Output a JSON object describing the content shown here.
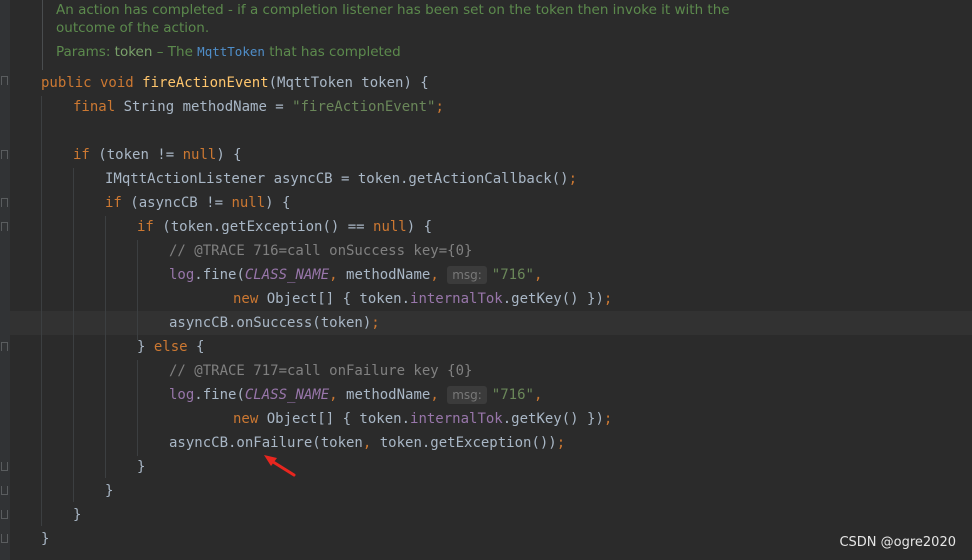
{
  "doc": {
    "line1": "An action has completed - if a completion listener has been set on the token then invoke it with the",
    "line2": "outcome of the action.",
    "params_label": "Params:",
    "param_name": "token",
    "param_dash": " – The ",
    "param_type": "MqttToken",
    "param_rest": " that has completed"
  },
  "code": {
    "l1": {
      "kw": "public void ",
      "fn": "fireActionEvent",
      "rest": "(MqttToken token) {"
    },
    "l2": {
      "kw": "final ",
      "a": "String methodName = ",
      "str": "\"fireActionEvent\"",
      "semi": ";"
    },
    "l4": {
      "kw": "if ",
      "a": "(token != ",
      "null": "null",
      "b": ") {"
    },
    "l5": {
      "a": "IMqttActionListener asyncCB = token.getActionCallback()",
      "semi": ";"
    },
    "l6": {
      "kw": "if ",
      "a": "(asyncCB != ",
      "null": "null",
      "b": ") {"
    },
    "l7": {
      "kw": "if ",
      "a": "(token.getException() == ",
      "null": "null",
      "b": ") {"
    },
    "l8": "// @TRACE 716=call onSuccess key={0}",
    "l9": {
      "field": "log",
      "a": ".fine(",
      "const": "CLASS_NAME",
      "comma": ", ",
      "b": "methodName",
      "comma2": ", ",
      "hint": "msg:",
      "str": "\"716\"",
      "comma3": ","
    },
    "l10": {
      "kw": "new ",
      "a": "Object[] { token.",
      "field": "internalTok",
      "b": ".getKey() })",
      "semi": ";"
    },
    "l11": {
      "a": "asyncCB.onSuccess(token)",
      "semi": ";"
    },
    "l12": {
      "a": "} ",
      "kw": "else",
      "b": " {"
    },
    "l13": "// @TRACE 717=call onFailure key {0}",
    "l14": {
      "field": "log",
      "a": ".fine(",
      "const": "CLASS_NAME",
      "comma": ", ",
      "b": "methodName",
      "comma2": ", ",
      "hint": "msg:",
      "str": "\"716\"",
      "comma3": ","
    },
    "l15": {
      "kw": "new ",
      "a": "Object[] { token.",
      "field": "internalTok",
      "b": ".getKey() })",
      "semi": ";"
    },
    "l16": {
      "a": "asyncCB.onFailure(token",
      "comma": ", ",
      "b": "token.getException())",
      "semi": ";"
    },
    "l17": "}",
    "l18": "}",
    "l19": "}",
    "l20": "}"
  },
  "watermark": "CSDN @ogre2020",
  "colors": {
    "background": "#2b2b2b",
    "keyword": "#cc7832",
    "function": "#ffc66d",
    "string": "#6a8759",
    "comment": "#808080",
    "field": "#9876aa",
    "arrow": "#e8261f"
  }
}
